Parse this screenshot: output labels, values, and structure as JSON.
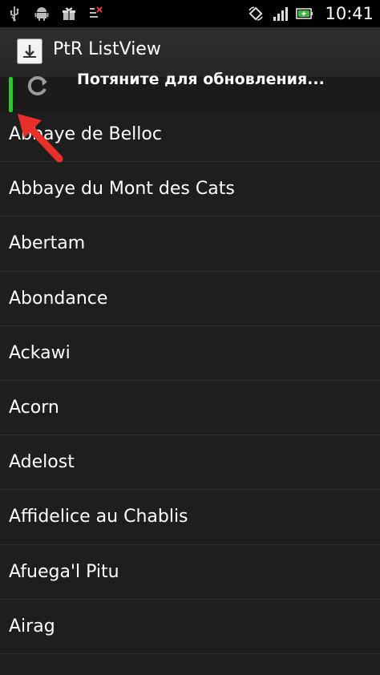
{
  "status_bar": {
    "icons": [
      "usb-icon",
      "android-icon",
      "gift-icon",
      "signal-off-icon",
      "screen-rotate-icon",
      "cell-signal-icon",
      "battery-charging-icon"
    ],
    "time": "10:41"
  },
  "action_bar": {
    "app_icon": "download-app-icon",
    "title": "PtR ListView"
  },
  "pull_to_refresh": {
    "label": "Потяните для обновления...",
    "icon": "refresh-icon",
    "indicator_color": "#22cc22"
  },
  "list": {
    "items": [
      "Abbaye de Belloc",
      "Abbaye du Mont des Cats",
      "Abertam",
      "Abondance",
      "Ackawi",
      "Acorn",
      "Adelost",
      "Affidelice au Chablis",
      "Afuega'l Pitu",
      "Airag"
    ]
  },
  "colors": {
    "background": "#1e1e1e",
    "status_bar": "#000000",
    "action_bar": "#2a2a2a",
    "accent_arrow": "#e8302a"
  }
}
